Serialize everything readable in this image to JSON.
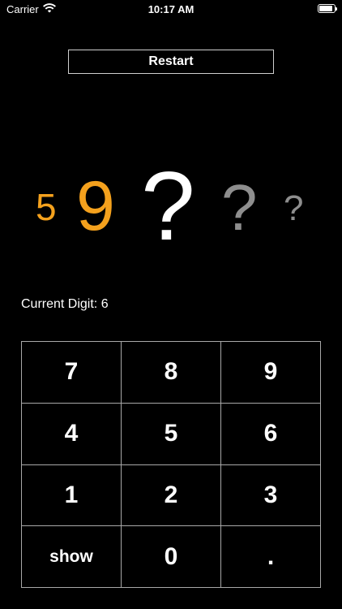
{
  "status_bar": {
    "carrier": "Carrier",
    "time": "10:17 AM",
    "battery_level": 0.9
  },
  "controls": {
    "restart_label": "Restart"
  },
  "digits": [
    "5",
    "9",
    "?",
    "?",
    "?"
  ],
  "current_digit": {
    "label": "Current Digit: 6"
  },
  "keypad": {
    "keys": [
      "7",
      "8",
      "9",
      "4",
      "5",
      "6",
      "1",
      "2",
      "3",
      "show",
      "0",
      "."
    ]
  },
  "colors": {
    "revealed": "#f4a11d",
    "active": "#ffffff",
    "pending": "#8e8e8e",
    "background": "#000000"
  }
}
